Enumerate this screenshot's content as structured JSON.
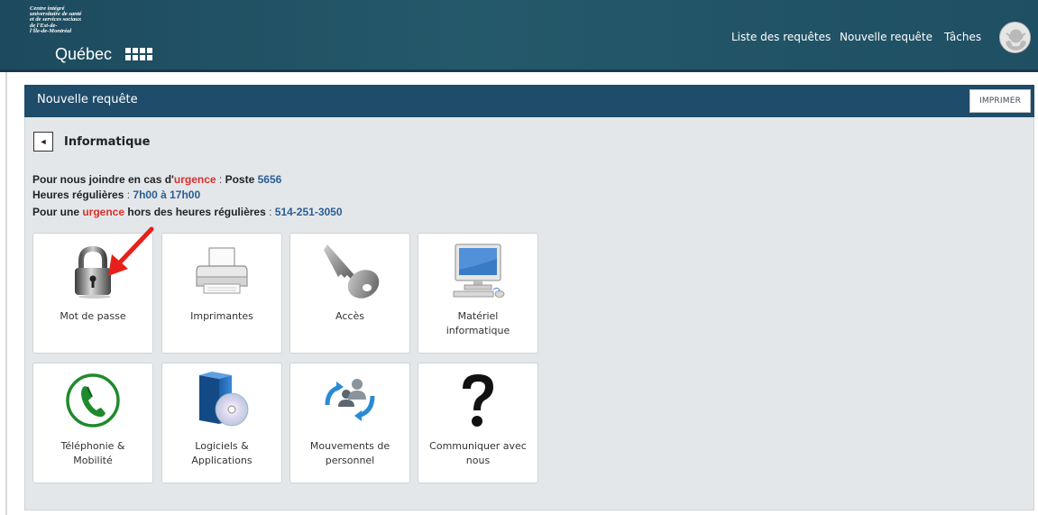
{
  "header": {
    "logo_lines": [
      "Centre intégré",
      "universitaire de santé",
      "et de services sociaux",
      "de l'Est-de-",
      "l'Île-de-Montréal"
    ],
    "logo_quebec": "Québec",
    "nav": {
      "liste": "Liste des requêtes",
      "nouvelle": "Nouvelle requête",
      "taches": "Tâches"
    }
  },
  "panel": {
    "title": "Nouvelle requête",
    "print_label": "IMPRIMER"
  },
  "section": {
    "back_symbol": "◄",
    "title": "Informatique"
  },
  "info": {
    "line1": {
      "a": "Pour nous joindre en cas d'",
      "urgence": "urgence",
      "b": " : ",
      "c": "Poste ",
      "num": "5656"
    },
    "line2": {
      "a": "Heures régulières",
      "b": " : ",
      "hours": "7h00 à 17h00"
    },
    "line3": {
      "a": "Pour une ",
      "urgence": "urgence",
      "b": " hors des heures régulières",
      "c": " : ",
      "num": "514-251-3050"
    }
  },
  "tiles": [
    {
      "label": "Mot de passe",
      "icon": "padlock-icon"
    },
    {
      "label": "Imprimantes",
      "icon": "printer-icon"
    },
    {
      "label": "Accès",
      "icon": "key-icon"
    },
    {
      "label_l1": "Matériel",
      "label_l2": "informatique",
      "icon": "computer-icon"
    },
    {
      "label_l1": "Téléphonie &",
      "label_l2": "Mobilité",
      "icon": "phone-icon"
    },
    {
      "label_l1": "Logiciels &",
      "label_l2": "Applications",
      "icon": "software-icon"
    },
    {
      "label_l1": "Mouvements de",
      "label_l2": "personnel",
      "icon": "people-exchange-icon"
    },
    {
      "label_l1": "Communiquer avec",
      "label_l2": "nous",
      "icon": "question-mark-icon"
    }
  ],
  "colors": {
    "header_bg": "#24596a",
    "panel_header_bg": "#1e4c6a",
    "urgence_red": "#d9302b",
    "link_blue": "#2a5d93",
    "arrow_red": "#e8201b"
  }
}
